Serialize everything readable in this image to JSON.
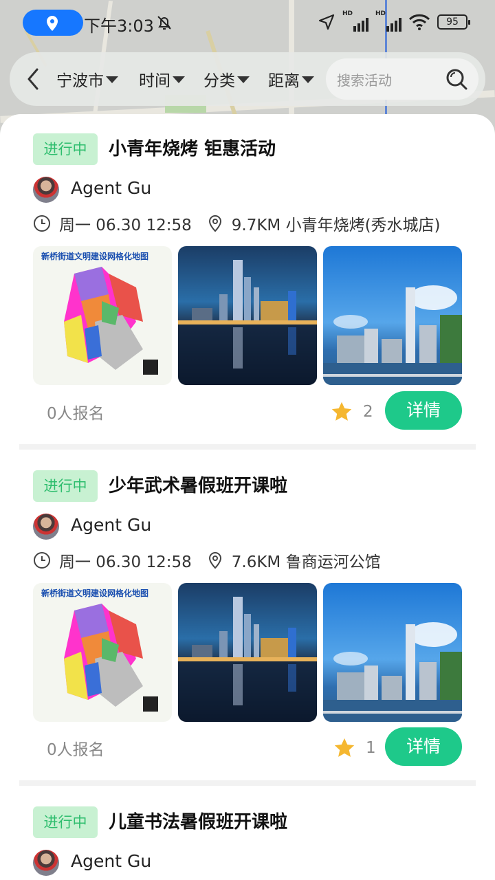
{
  "status_bar": {
    "time": "下午3:03",
    "battery": "95",
    "hd1": "HD",
    "hd2": "HD",
    "icons": [
      "location-pin-icon",
      "mute-bell-icon",
      "navigation-arrow-icon",
      "signal-icon",
      "wifi-icon",
      "battery-icon"
    ]
  },
  "filter_bar": {
    "city": "宁波市",
    "time": "时间",
    "category": "分类",
    "distance": "距离",
    "search_placeholder": "搜索活动"
  },
  "activities": [
    {
      "status": "进行中",
      "title": "小青年烧烤 钜惠活动",
      "author": "Agent Gu",
      "datetime": "周一 06.30 12:58",
      "location": "9.7KM 小青年烧烤(秀水城店)",
      "enrolled": "0人报名",
      "stars": "2",
      "detail_label": "详情",
      "map_header": "新桥街道文明建设网格化地图"
    },
    {
      "status": "进行中",
      "title": "少年武术暑假班开课啦",
      "author": "Agent Gu",
      "datetime": "周一 06.30 12:58",
      "location": "7.6KM 鲁商运河公馆",
      "enrolled": "0人报名",
      "stars": "1",
      "detail_label": "详情",
      "map_header": "新桥街道文明建设网格化地图"
    },
    {
      "status": "进行中",
      "title": "儿童书法暑假班开课啦",
      "author": "Agent Gu"
    }
  ],
  "colors": {
    "accent": "#1ec98a",
    "badge_bg": "#c8f1d2",
    "badge_text": "#2dbd6d",
    "star": "#f5b730",
    "location_pill": "#1677ff"
  }
}
